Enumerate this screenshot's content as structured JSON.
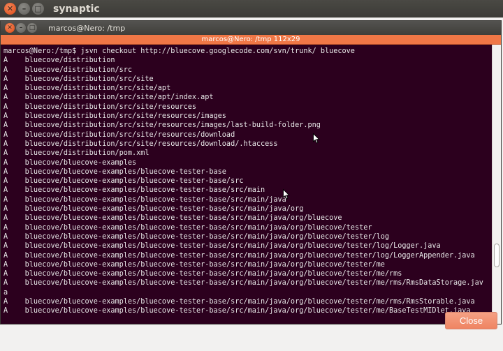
{
  "window": {
    "title": "synaptic",
    "close_glyph": "✕",
    "minimize_glyph": "–",
    "maximize_glyph": "□"
  },
  "terminal": {
    "title": "marcos@Nero: /tmp",
    "tab_label": "marcos@Nero: /tmp 112x29",
    "background": "#2c001e",
    "text_color": "#e8e8e8",
    "lines": [
      "marcos@Nero:/tmp$ jsvn checkout http://bluecove.googlecode.com/svn/trunk/ bluecove",
      "A    bluecove/distribution",
      "A    bluecove/distribution/src",
      "A    bluecove/distribution/src/site",
      "A    bluecove/distribution/src/site/apt",
      "A    bluecove/distribution/src/site/apt/index.apt",
      "A    bluecove/distribution/src/site/resources",
      "A    bluecove/distribution/src/site/resources/images",
      "A    bluecove/distribution/src/site/resources/images/last-build-folder.png",
      "A    bluecove/distribution/src/site/resources/download",
      "A    bluecove/distribution/src/site/resources/download/.htaccess",
      "A    bluecove/distribution/pom.xml",
      "A    bluecove/bluecove-examples",
      "A    bluecove/bluecove-examples/bluecove-tester-base",
      "A    bluecove/bluecove-examples/bluecove-tester-base/src",
      "A    bluecove/bluecove-examples/bluecove-tester-base/src/main",
      "A    bluecove/bluecove-examples/bluecove-tester-base/src/main/java",
      "A    bluecove/bluecove-examples/bluecove-tester-base/src/main/java/org",
      "A    bluecove/bluecove-examples/bluecove-tester-base/src/main/java/org/bluecove",
      "A    bluecove/bluecove-examples/bluecove-tester-base/src/main/java/org/bluecove/tester",
      "A    bluecove/bluecove-examples/bluecove-tester-base/src/main/java/org/bluecove/tester/log",
      "A    bluecove/bluecove-examples/bluecove-tester-base/src/main/java/org/bluecove/tester/log/Logger.java",
      "A    bluecove/bluecove-examples/bluecove-tester-base/src/main/java/org/bluecove/tester/log/LoggerAppender.java",
      "A    bluecove/bluecove-examples/bluecove-tester-base/src/main/java/org/bluecove/tester/me",
      "A    bluecove/bluecove-examples/bluecove-tester-base/src/main/java/org/bluecove/tester/me/rms",
      "A    bluecove/bluecove-examples/bluecove-tester-base/src/main/java/org/bluecove/tester/me/rms/RmsDataStorage.jav",
      "a",
      "A    bluecove/bluecove-examples/bluecove-tester-base/src/main/java/org/bluecove/tester/me/rms/RmsStorable.java",
      "A    bluecove/bluecove-examples/bluecove-tester-base/src/main/java/org/bluecove/tester/me/BaseTestMIDlet.java"
    ]
  },
  "footer": {
    "close_label": "Close",
    "close_bg": "#f08a66"
  },
  "icons": {
    "mouse_pointer": "mouse-pointer-icon"
  }
}
